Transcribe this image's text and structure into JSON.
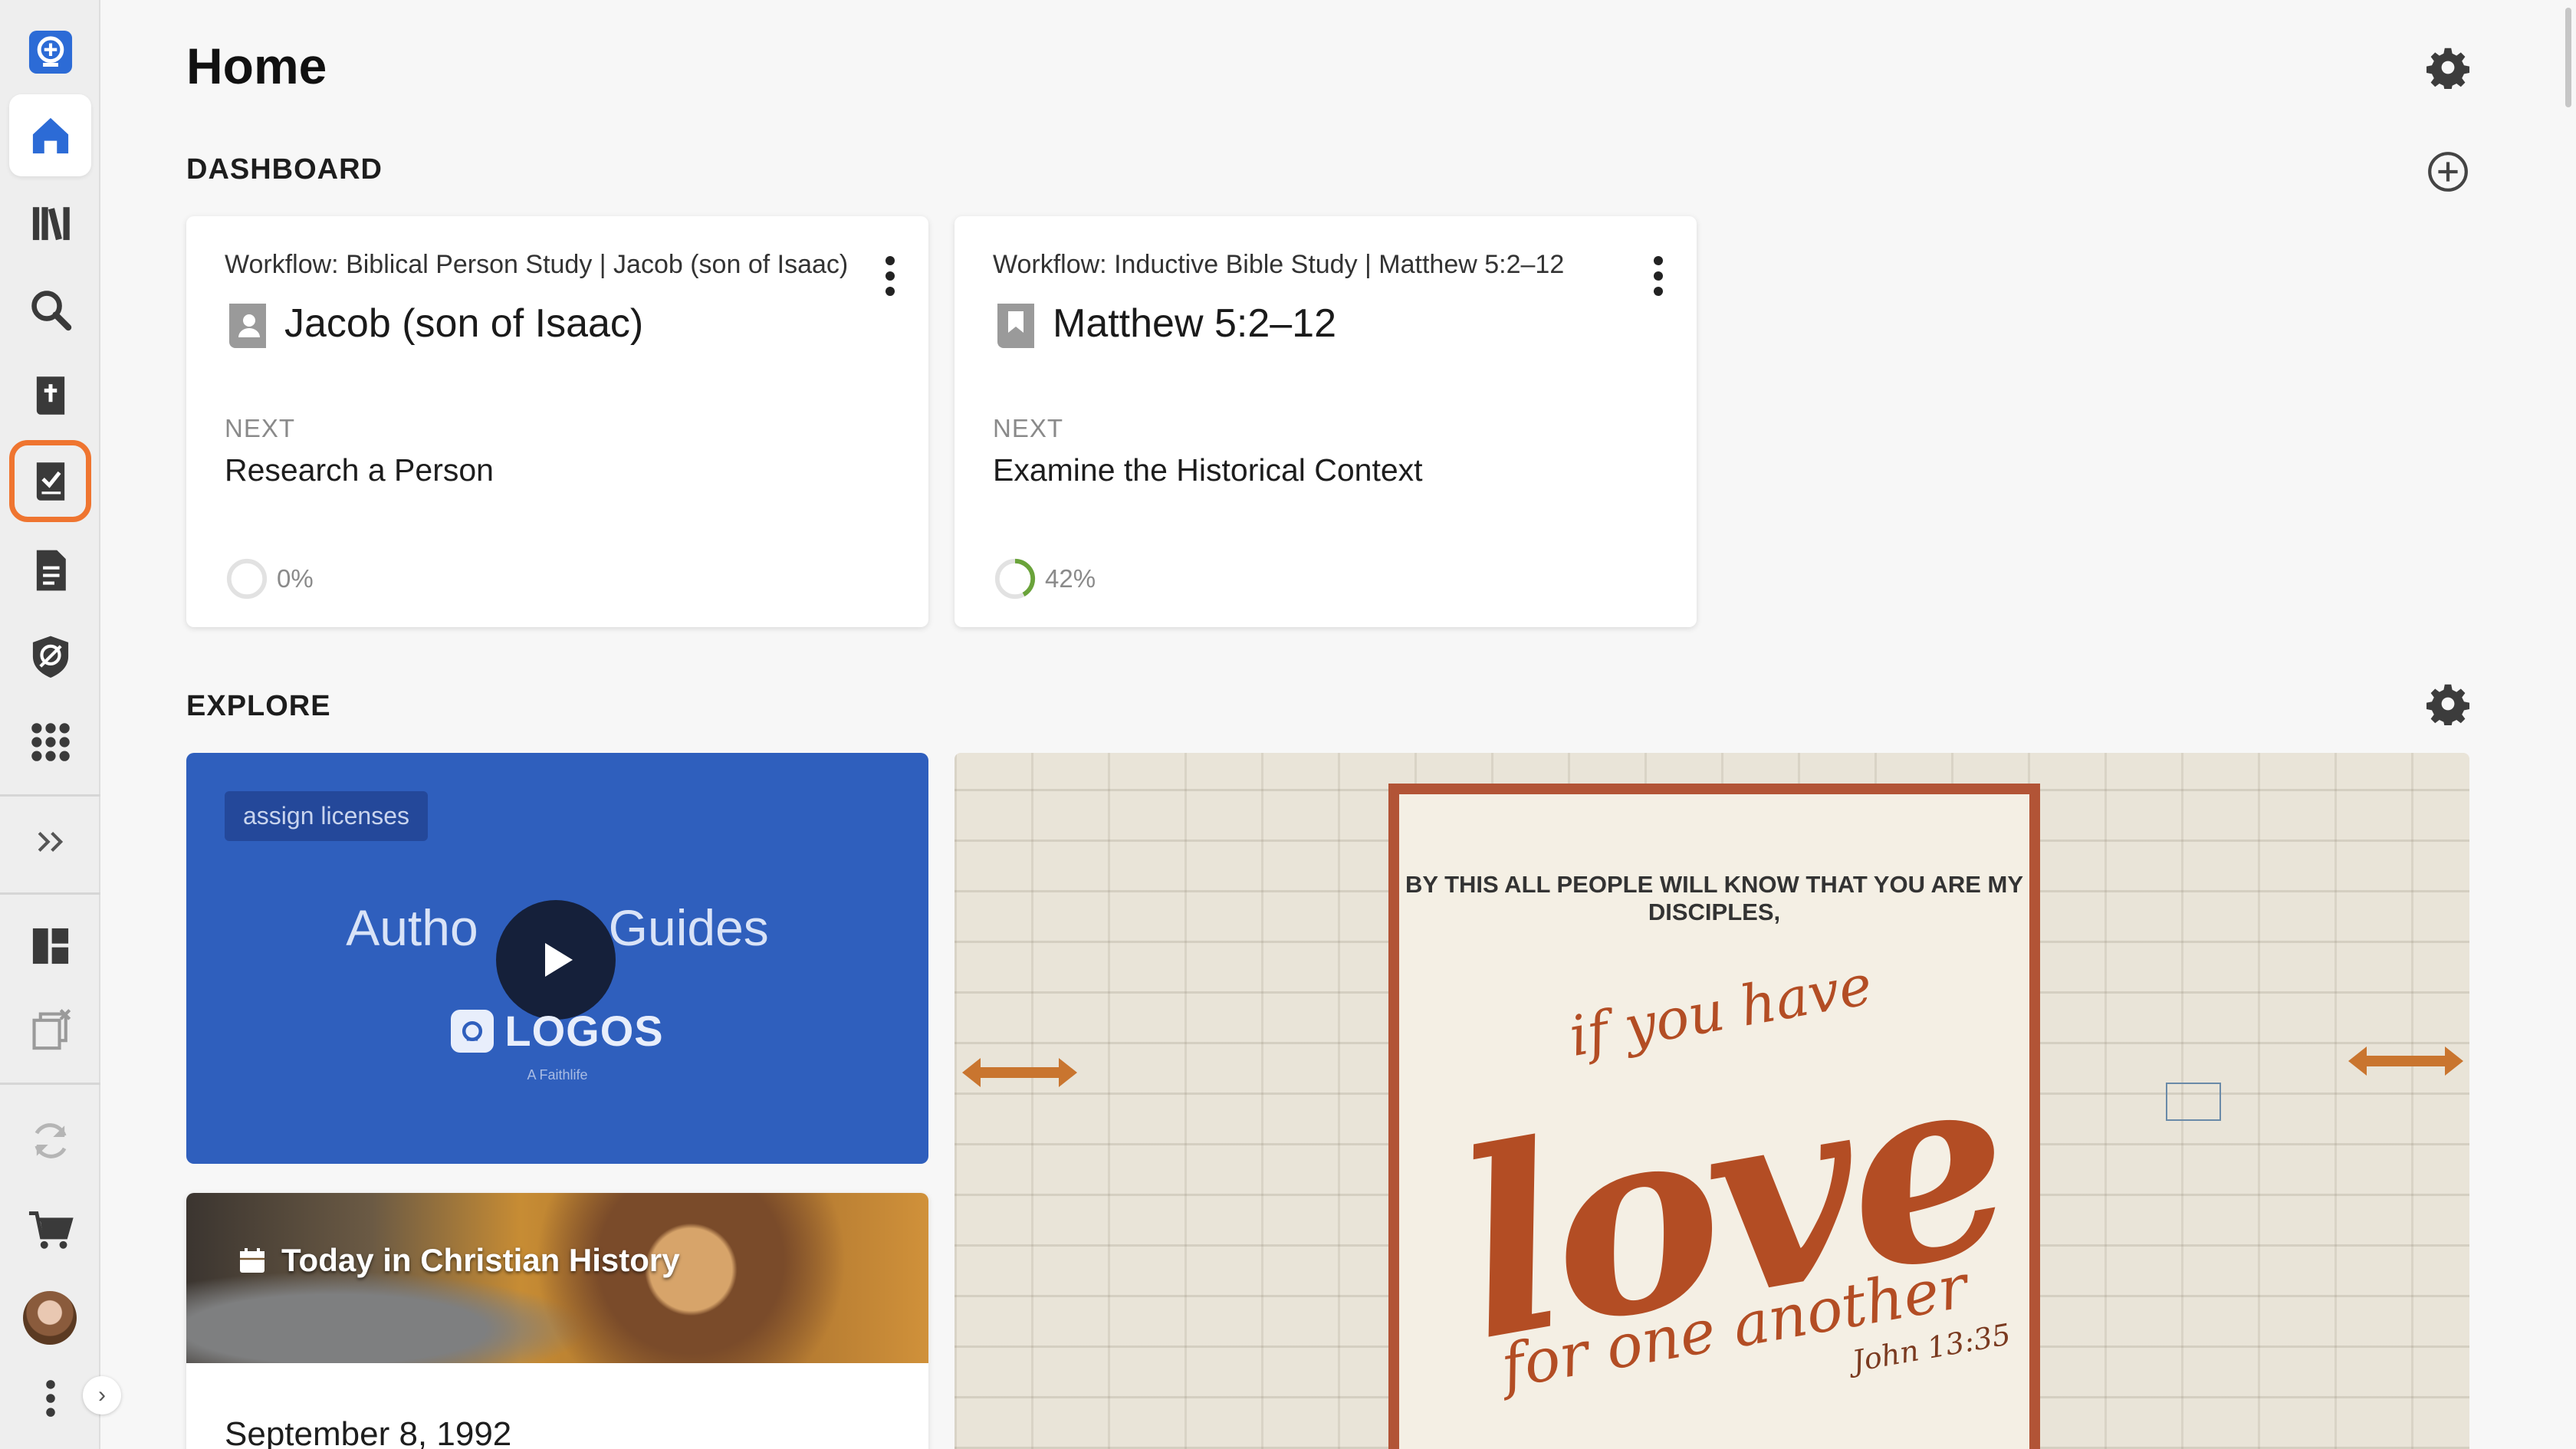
{
  "sidebar": {
    "icons": [
      "app-logo-icon",
      "home-icon",
      "library-icon",
      "search-icon",
      "bible-icon",
      "workflows-icon",
      "documents-icon",
      "guides-icon",
      "apps-icon",
      "expand-icon",
      "layouts-icon",
      "close-panels-icon",
      "sync-icon",
      "cart-icon",
      "avatar",
      "more-icon"
    ],
    "active": "home",
    "highlighted": "workflows",
    "accent_color": "#ef7530",
    "brand_color": "#2c6bd6"
  },
  "page": {
    "title": "Home"
  },
  "dashboard": {
    "title": "DASHBOARD",
    "cards": [
      {
        "subtitle": "Workflow: Biblical Person Study | Jacob (son of Isaac)",
        "title": "Jacob (son of Isaac)",
        "next_label": "NEXT",
        "next_step": "Research a Person",
        "progress_label": "0%",
        "progress": 0
      },
      {
        "subtitle": "Workflow: Inductive Bible Study | Matthew 5:2–12",
        "title": "Matthew 5:2–12",
        "next_label": "NEXT",
        "next_step": "Examine the Historical Context",
        "progress_label": "42%",
        "progress": 0.42
      }
    ]
  },
  "explore": {
    "title": "EXPLORE",
    "video": {
      "badge": "assign licenses",
      "title_left": "Autho",
      "title_right": "Guides",
      "logo": "LOGOS",
      "logo_sub": "A Faithlife"
    },
    "history": {
      "label": "Today in Christian History",
      "date": "September 8, 1992"
    },
    "verse_image": {
      "top_line": "BY THIS ALL PEOPLE WILL KNOW THAT YOU ARE MY DISCIPLES,",
      "line1": "if you have",
      "line2": "love",
      "line3": "for one another",
      "reference": "John 13:35"
    }
  }
}
